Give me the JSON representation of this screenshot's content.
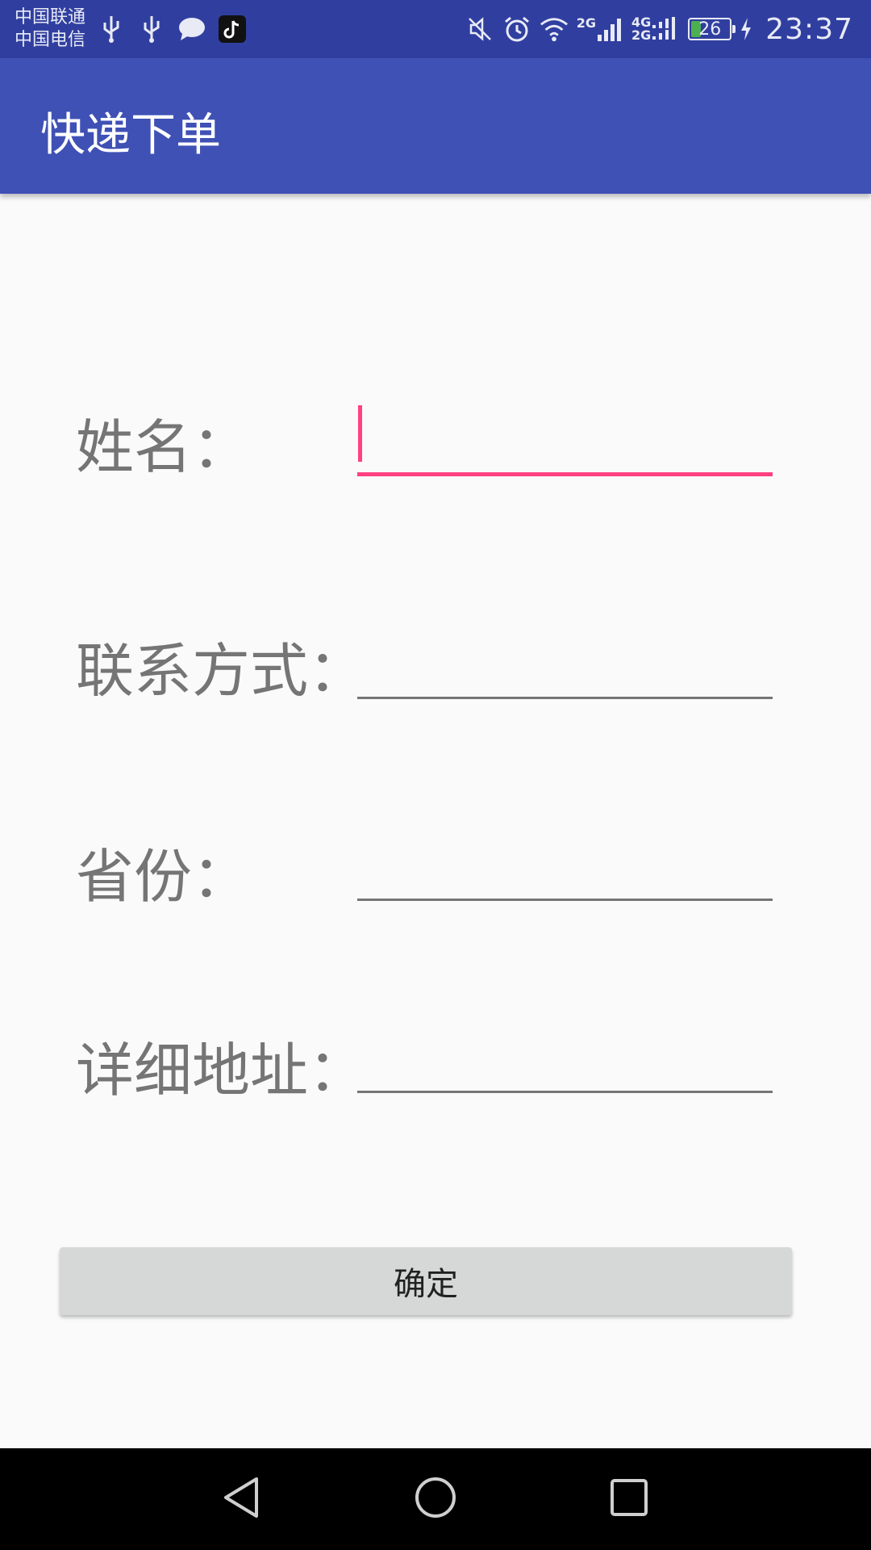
{
  "status_bar": {
    "carrier_1": "中国联通",
    "carrier_2": "中国电信",
    "net_2g": "2G",
    "net_4g": "4G",
    "net_2g_b": "2G",
    "battery_level": "26",
    "time": "23:37",
    "icons": [
      "usb-icon",
      "usb-icon",
      "message-icon",
      "tiktok-icon",
      "mute-icon",
      "alarm-icon",
      "wifi-icon",
      "signal-icon",
      "battery-icon",
      "charging-icon"
    ]
  },
  "app_bar": {
    "title": "快递下单",
    "color": "#3f51b5"
  },
  "form": {
    "fields": [
      {
        "label": "姓名：",
        "value": "",
        "focused": true
      },
      {
        "label": "联系方式：",
        "value": ""
      },
      {
        "label": "省份：",
        "value": ""
      },
      {
        "label": "详细地址：",
        "value": ""
      }
    ],
    "accent_color": "#ff4081"
  },
  "confirm_button": {
    "label": "确定"
  },
  "nav_bar": {
    "buttons": [
      "back-icon",
      "home-icon",
      "recents-icon"
    ]
  }
}
